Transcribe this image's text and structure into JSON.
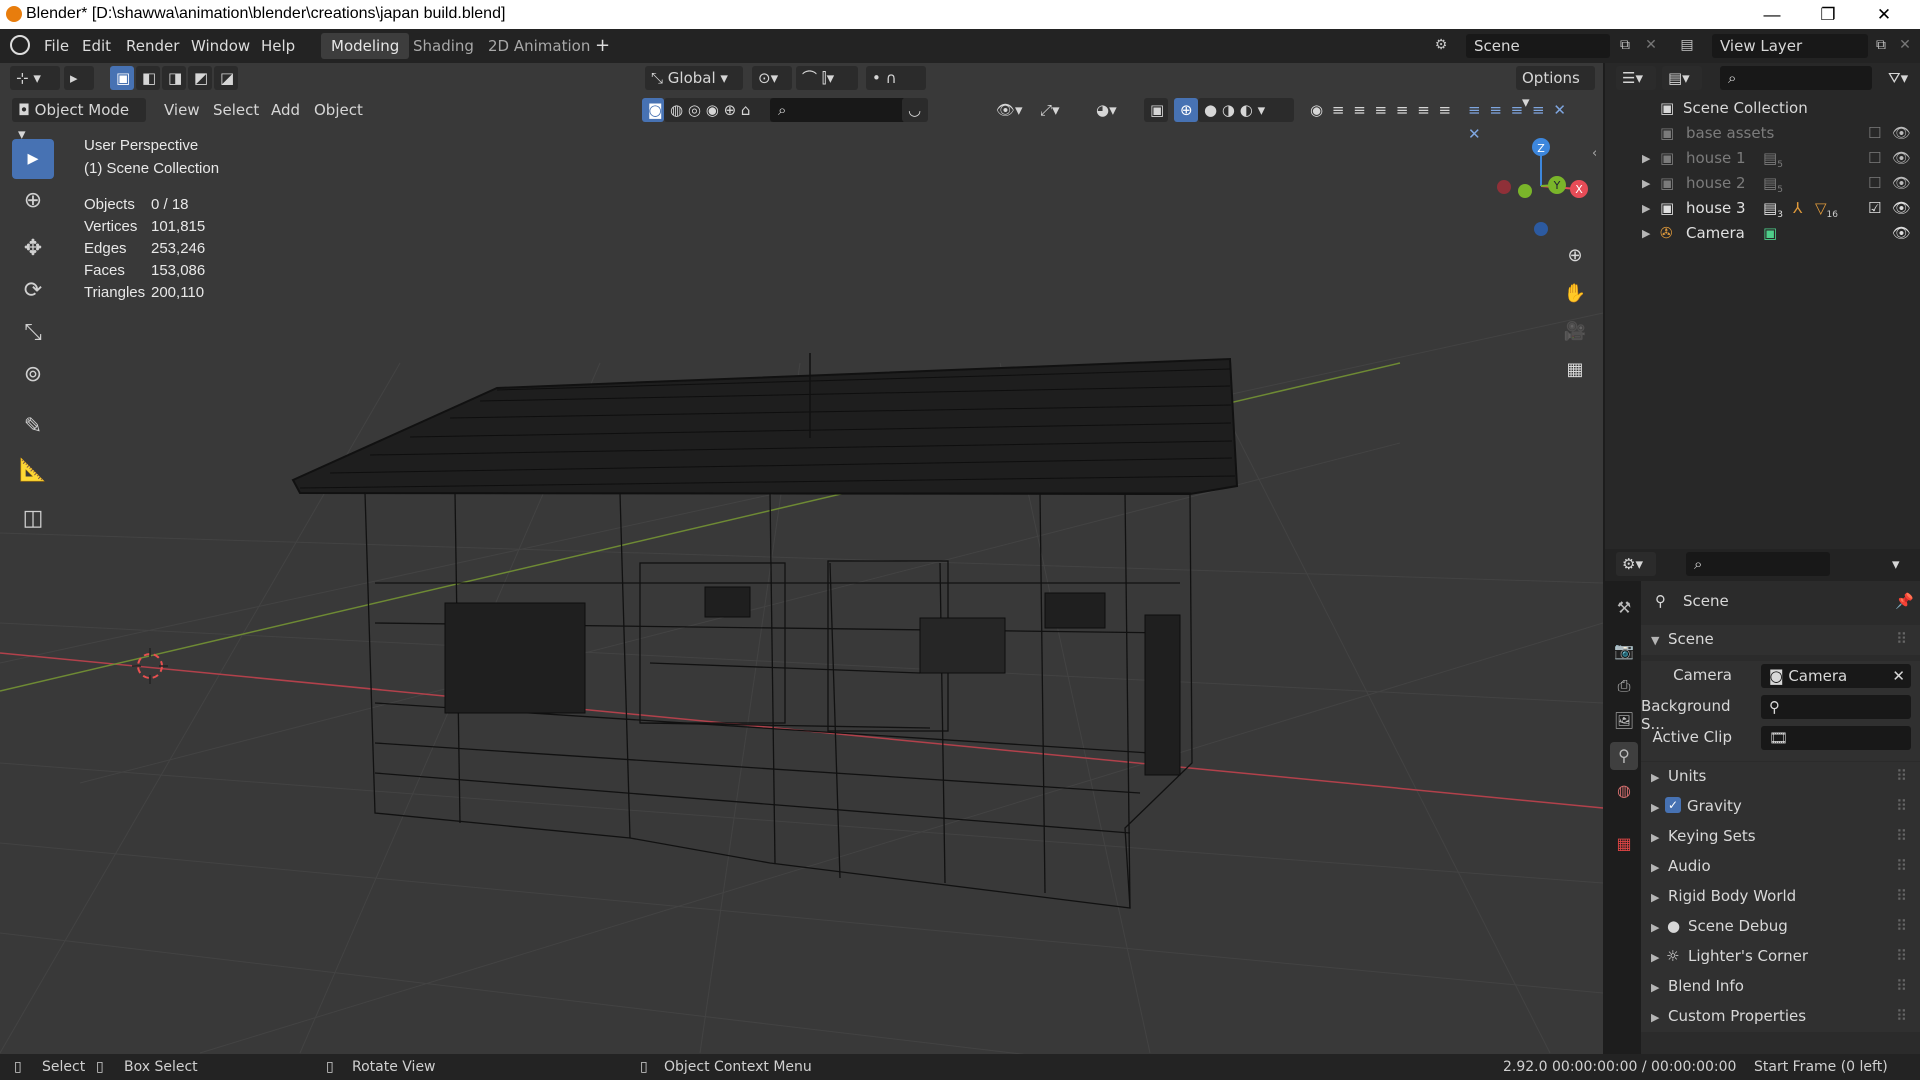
{
  "window": {
    "title": "Blender* [D:\\shawwa\\animation\\blender\\creations\\japan build.blend]",
    "minimize": "—",
    "maximize": "❐",
    "close": "✕"
  },
  "menubar": {
    "items": [
      "File",
      "Edit",
      "Render",
      "Window",
      "Help"
    ],
    "workspaces": [
      "Modeling",
      "Shading",
      "2D Animation"
    ],
    "add_workspace": "+",
    "scene": "Scene",
    "view_layer": "View Layer"
  },
  "viewport_header": {
    "mode": "Object Mode",
    "menus": [
      "View",
      "Select",
      "Add",
      "Object"
    ],
    "transform_orientation": "Global",
    "options": "Options"
  },
  "viewport_overlay": {
    "view_name": "User Perspective",
    "collection": "(1) Scene Collection",
    "stats": [
      {
        "label": "Objects",
        "value": "0 / 18"
      },
      {
        "label": "Vertices",
        "value": "101,815"
      },
      {
        "label": "Edges",
        "value": "253,246"
      },
      {
        "label": "Faces",
        "value": "153,086"
      },
      {
        "label": "Triangles",
        "value": "200,110"
      }
    ],
    "gizmo": {
      "z": "Z",
      "y": "Y",
      "x": "X"
    }
  },
  "outliner": {
    "root": "Scene Collection",
    "items": [
      {
        "label": "base assets",
        "dim": true,
        "count": ""
      },
      {
        "label": "house 1",
        "dim": true,
        "count": "5"
      },
      {
        "label": "house 2",
        "dim": true,
        "count": "5"
      },
      {
        "label": "house 3",
        "dim": false,
        "count": "3",
        "extra_count": "16"
      },
      {
        "label": "Camera",
        "dim": false,
        "count": ""
      }
    ]
  },
  "properties": {
    "context": "Scene",
    "panel_title": "Scene",
    "camera_label": "Camera",
    "camera_value": "Camera",
    "background_label": "Background S...",
    "active_clip_label": "Active Clip",
    "panels": [
      "Units",
      "Gravity",
      "Keying Sets",
      "Audio",
      "Rigid Body World",
      "Scene Debug",
      "Lighter's Corner",
      "Blend Info",
      "Custom Properties"
    ]
  },
  "statusbar": {
    "select": "Select",
    "box_select": "Box Select",
    "rotate": "Rotate View",
    "context_menu": "Object Context Menu",
    "version": "2.92.0",
    "time": "00:00:00:00 / 00:00:00:00",
    "start_frame": "Start Frame (0 left)"
  },
  "colors": {
    "accent": "#4772b3",
    "axis_x": "#e74c57",
    "axis_y": "#7ab52a",
    "axis_z": "#3d87dd",
    "viewport_bg": "#393939"
  }
}
